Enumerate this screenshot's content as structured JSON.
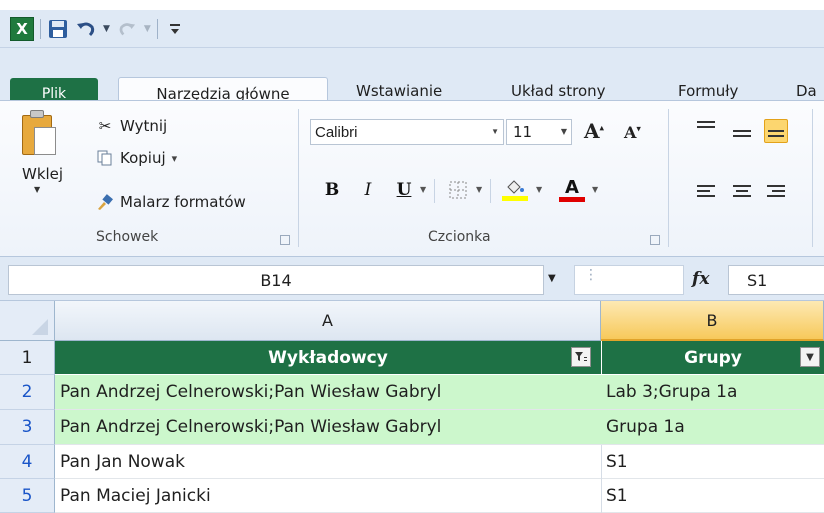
{
  "qat": {
    "app_icon": "X",
    "icons": [
      "excel-icon",
      "save-icon",
      "undo-icon",
      "redo-icon",
      "customize-icon"
    ]
  },
  "tabs": {
    "file": "Plik",
    "home": "Narzędzia główne",
    "insert": "Wstawianie",
    "page_layout": "Układ strony",
    "formulas": "Formuły",
    "data_partial": "Da"
  },
  "clipboard": {
    "paste": "Wklej",
    "cut": "Wytnij",
    "copy": "Kopiuj",
    "copy_arrow": "▾",
    "format_painter": "Malarz formatów",
    "group_label": "Schowek"
  },
  "font": {
    "name": "Calibri",
    "size": "11",
    "bold": "B",
    "italic": "I",
    "underline": "U",
    "group_label": "Czcionka",
    "fill_color": "#ffff00",
    "font_color": "#e00000"
  },
  "formula_bar": {
    "name_box": "B14",
    "fx": "fx",
    "content": "S1"
  },
  "grid": {
    "columns": [
      "A",
      "B"
    ],
    "selected_column": "B",
    "header_row": {
      "number": "1",
      "a": "Wykładowcy",
      "b": "Grupy"
    },
    "rows": [
      {
        "number": "2",
        "a": "Pan Andrzej Celnerowski;Pan Wiesław Gabryl",
        "b": "Lab 3;Grupa 1a",
        "highlight": true
      },
      {
        "number": "3",
        "a": "Pan Andrzej Celnerowski;Pan Wiesław Gabryl",
        "b": "Grupa 1a",
        "highlight": true
      },
      {
        "number": "4",
        "a": "Pan Jan Nowak",
        "b": "S1",
        "highlight": false
      },
      {
        "number": "5",
        "a": "Pan Maciej Janicki",
        "b": "S1",
        "highlight": false
      }
    ]
  },
  "colors": {
    "header_green": "#1e7145",
    "highlight_green": "#ccf7cc",
    "selected_col": "#f7c95b"
  }
}
